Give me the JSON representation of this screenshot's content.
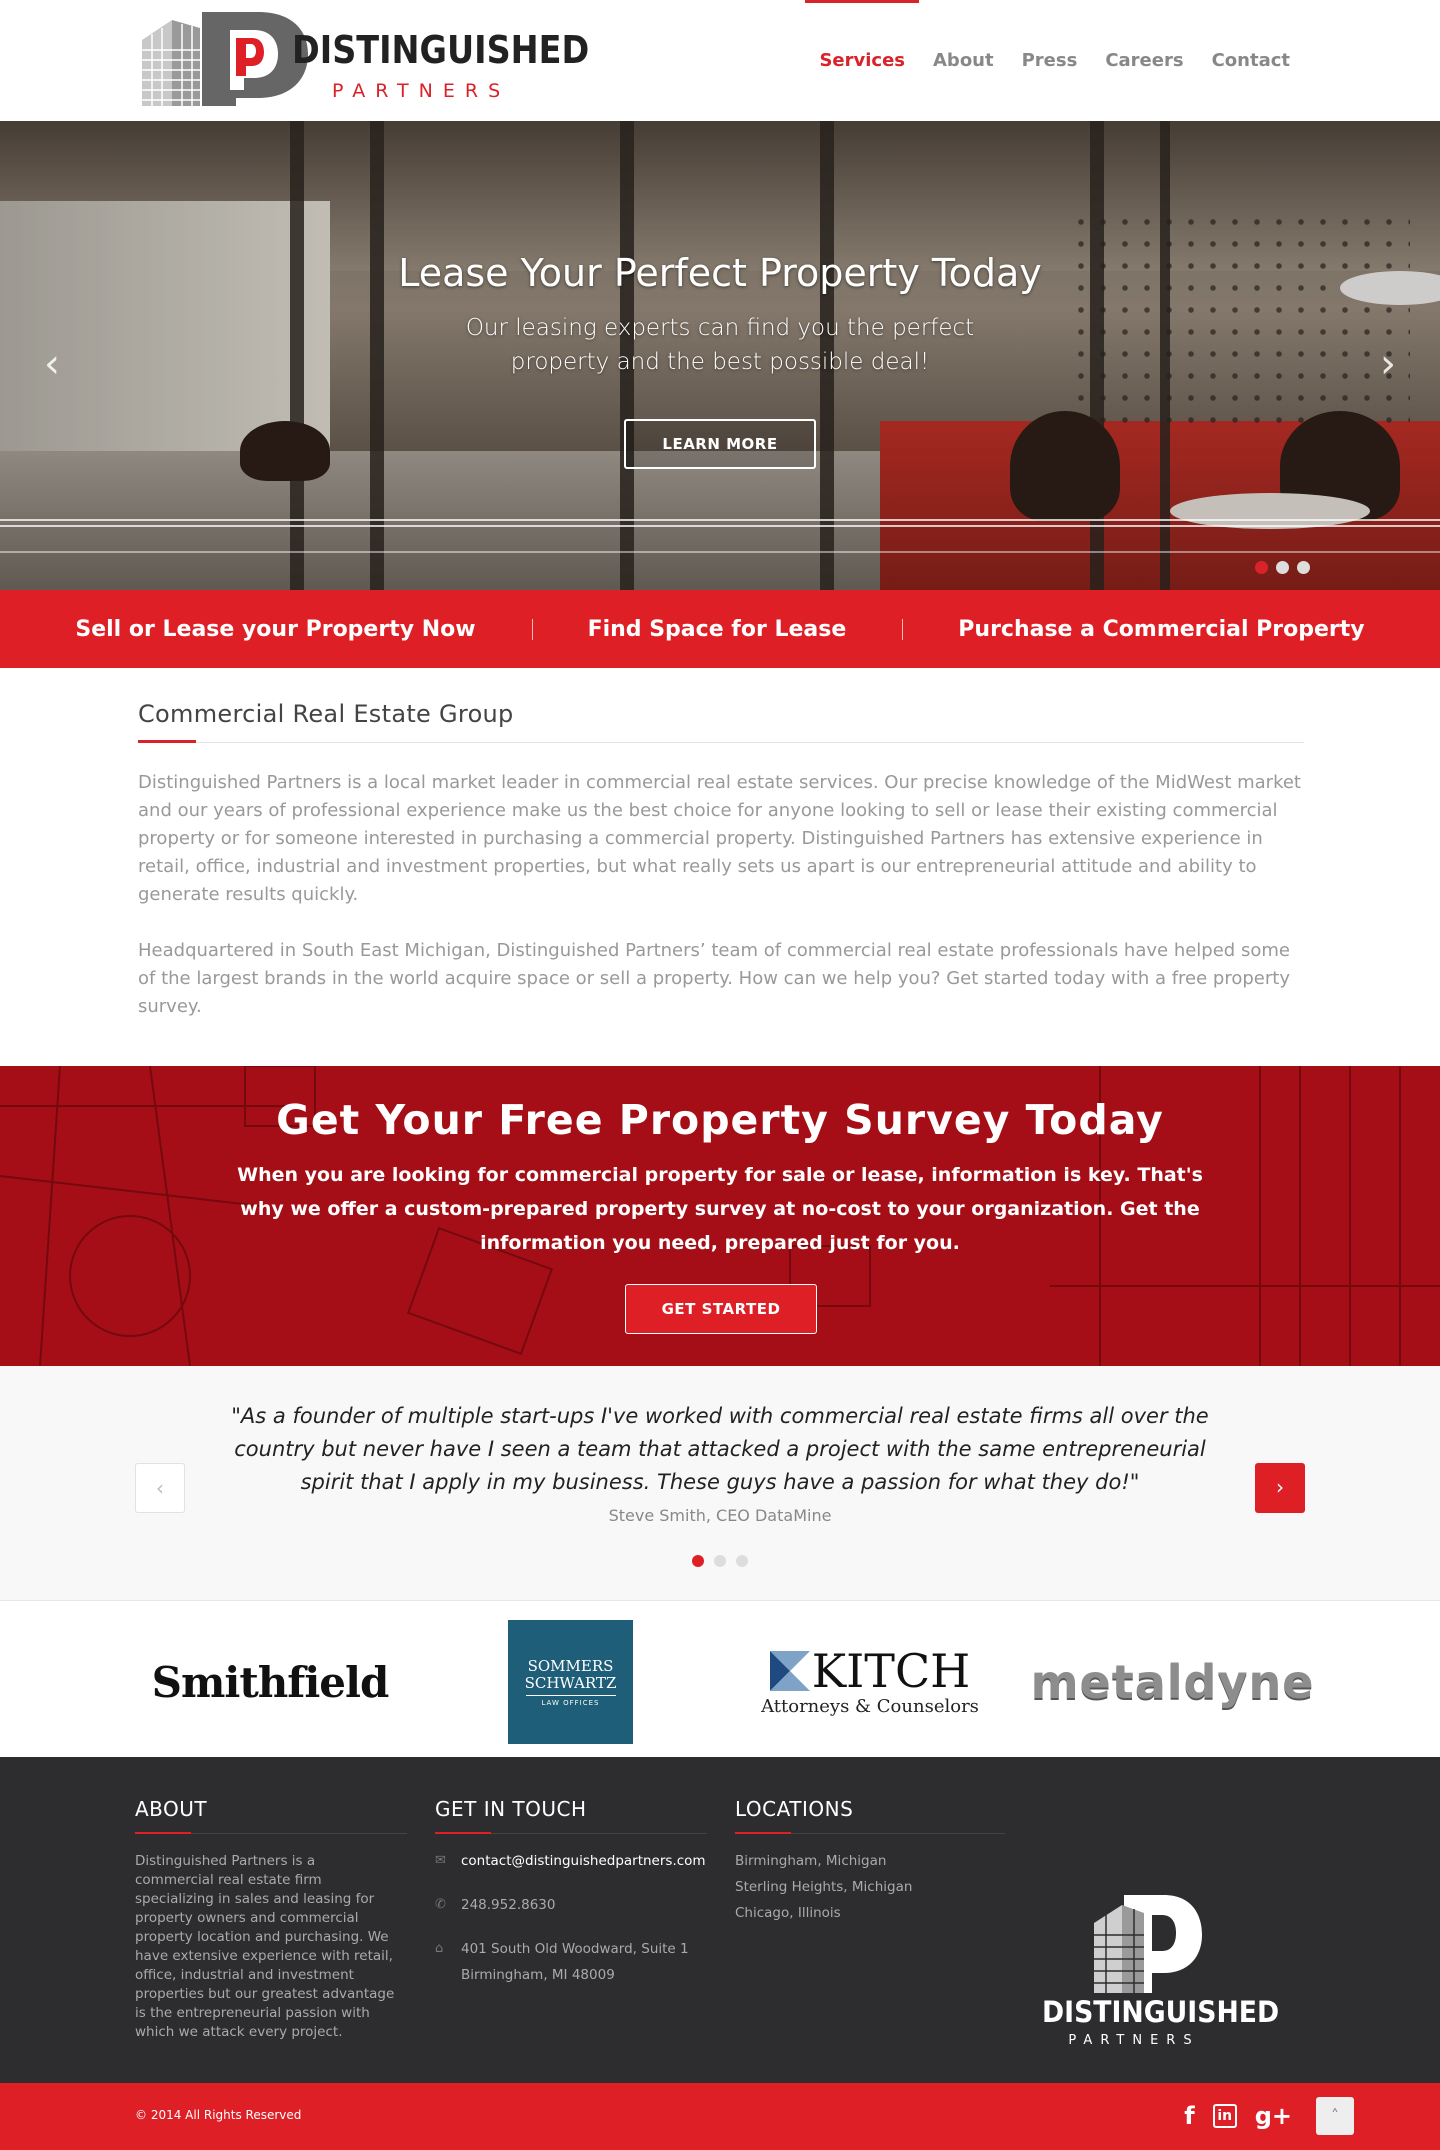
{
  "brand": {
    "name": "DISTINGUISHED",
    "subtitle": "PARTNERS",
    "accent": "#df1f26",
    "dark": "#2d2d2f"
  },
  "nav": {
    "items": [
      {
        "label": "Services",
        "active": true
      },
      {
        "label": "About"
      },
      {
        "label": "Press"
      },
      {
        "label": "Careers"
      },
      {
        "label": "Contact"
      }
    ]
  },
  "hero": {
    "title": "Lease Your Perfect Property Today",
    "text": "Our leasing experts can find you the perfect property and the best possible deal!",
    "button": "LEARN MORE",
    "prev_icon": "chevron-left-icon",
    "next_icon": "chevron-right-icon",
    "slides": 3,
    "active_slide": 1
  },
  "strip": {
    "links": [
      "Sell or Lease your Property Now",
      "Find Space for Lease",
      "Purchase a Commercial Property"
    ]
  },
  "intro": {
    "heading": "Commercial Real Estate Group",
    "p1": "Distinguished Partners is a local market leader in commercial real estate services. Our precise knowledge of the MidWest market and our years of professional experience make us the best choice for anyone looking to sell or lease their existing commercial property or for someone interested in purchasing a commercial property. Distinguished Partners has extensive experience in retail, office, industrial and investment properties, but what really sets us apart is our entrepreneurial attitude and ability to generate results quickly.",
    "p2": "Headquartered in South East Michigan, Distinguished Partners’ team of commercial real estate professionals have helped some of the largest brands in the world acquire space or sell a property. How can we help you? Get started today with a free property survey."
  },
  "survey": {
    "title": "Get Your Free Property Survey Today",
    "text": "When you are looking for commercial property for sale or lease, information is key. That's why we offer a custom-prepared property survey at no-cost to your organization. Get the information you need, prepared just for you.",
    "button": "GET STARTED"
  },
  "testimonial": {
    "quote": "\"As a founder of multiple start-ups I've worked with commercial real estate firms all over the country but never have I seen a team that attacked a project with the same entrepreneurial spirit that I apply in my business. These guys have a passion for what they do!\"",
    "cite": "Steve Smith, CEO DataMine",
    "prev": "‹",
    "next": "›",
    "dots": 3,
    "active_dot": 1
  },
  "clients": {
    "smithfield": "Smithfield",
    "sommers_line1": "SOMMERS",
    "sommers_line2": "SCHWARTZ",
    "sommers_tag": "LAW OFFICES",
    "kitch": "KITCH",
    "kitch_tag": "Attorneys & Counselors",
    "metaldyne": "metaldyne"
  },
  "footer": {
    "about_title": "ABOUT",
    "about_text": "Distinguished Partners is a commercial real estate firm specializing in sales and leasing for property owners and commercial property location and purchasing. We have extensive experience with retail, office, industrial and investment properties but our greatest advantage is the entrepreneurial passion with which we attack every project.",
    "contact_title": "GET IN TOUCH",
    "email": "contact@distinguishedpartners.com",
    "phone": "248.952.8630",
    "address1": "401 South Old Woodward, Suite 1",
    "address2": "Birmingham, MI 48009",
    "locations_title": "LOCATIONS",
    "locations": [
      "Birmingham, Michigan",
      "Sterling Heights, Michigan",
      "Chicago, Illinois"
    ],
    "logo_name": "DISTINGUISHED",
    "logo_sub": "PARTNERS"
  },
  "bottom": {
    "copyright": "© 2014 All Rights Reserved",
    "social": [
      "facebook-icon",
      "linkedin-icon",
      "google-plus-icon"
    ],
    "facebook": "f",
    "linkedin": "in",
    "gplus": "g+",
    "up": "˄"
  }
}
